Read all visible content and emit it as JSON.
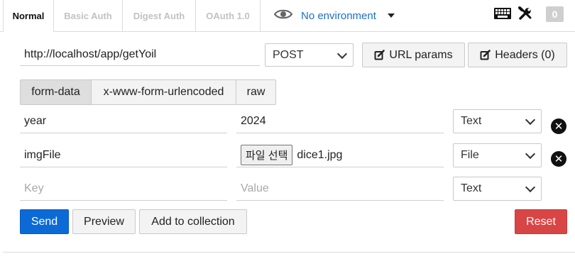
{
  "tabs": [
    {
      "label": "Normal",
      "active": true
    },
    {
      "label": "Basic Auth"
    },
    {
      "label": "Digest Auth"
    },
    {
      "label": "OAuth 1.0"
    }
  ],
  "environment": {
    "label": "No environment"
  },
  "badge": "0",
  "request": {
    "url": "http://localhost/app/getYoil",
    "method": "POST",
    "url_params_label": "URL params",
    "headers_label": "Headers (0)"
  },
  "body_types": [
    {
      "label": "form-data",
      "active": true
    },
    {
      "label": "x-www-form-urlencoded"
    },
    {
      "label": "raw"
    }
  ],
  "form_rows": [
    {
      "key": "year",
      "value": "2024",
      "type": "Text"
    },
    {
      "key": "imgFile",
      "file_button": "파일 선택",
      "file_name": "dice1.jpg",
      "type": "File"
    }
  ],
  "new_row": {
    "key_placeholder": "Key",
    "value_placeholder": "Value",
    "type": "Text"
  },
  "actions": {
    "send": "Send",
    "preview": "Preview",
    "add_to_collection": "Add to collection",
    "reset": "Reset"
  },
  "colors": {
    "accent": "#1a6fc8",
    "send": "#0b6ad6",
    "reset": "#d94545"
  }
}
